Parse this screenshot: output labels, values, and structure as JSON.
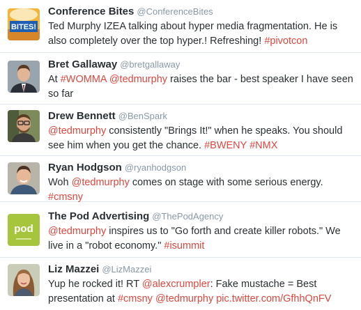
{
  "colors": {
    "link": "#e0463d",
    "name": "#292f33",
    "handle": "#8899a6",
    "divider": "#e1e8ed"
  },
  "tweets": [
    {
      "name": "Conference Bites",
      "handle": "@ConferenceBites",
      "avatar": {
        "icon": "bites-logo",
        "text": "BITES!"
      },
      "segments": [
        {
          "text": "Ted Murphy IZEA talking about hyper media fragmentation. He is also completely over the top hyper.! Refreshing! "
        },
        {
          "text": "#pivotcon"
        }
      ]
    },
    {
      "name": "Bret Gallaway",
      "handle": "@bretgallaway",
      "avatar": {
        "icon": "user-photo"
      },
      "segments": [
        {
          "text": "At "
        },
        {
          "text": "#WOMMA"
        },
        {
          "text": " "
        },
        {
          "text": "@tedmurphy"
        },
        {
          "text": " raises the bar - best speaker I have seen so far"
        }
      ]
    },
    {
      "name": "Drew Bennett",
      "handle": "@BenSpark",
      "avatar": {
        "icon": "user-photo"
      },
      "segments": [
        {
          "text": "@tedmurphy"
        },
        {
          "text": " consistently \"Brings It!\" when he speaks. You should see him when you get the chance. "
        },
        {
          "text": "#BWENY"
        },
        {
          "text": " "
        },
        {
          "text": "#NMX"
        }
      ]
    },
    {
      "name": "Ryan Hodgson",
      "handle": "@ryanhodgson",
      "avatar": {
        "icon": "user-photo"
      },
      "segments": [
        {
          "text": "Woh "
        },
        {
          "text": "@tedmurphy"
        },
        {
          "text": " comes on stage with some serious energy. "
        },
        {
          "text": "#cmsny"
        }
      ]
    },
    {
      "name": "The Pod Advertising",
      "handle": "@ThePodAgency",
      "avatar": {
        "icon": "pod-logo",
        "text": "pod"
      },
      "segments": [
        {
          "text": "@tedmurphy"
        },
        {
          "text": " inspires us to \"Go forth and create killer robots.\" We live in a \"robot economy.\" "
        },
        {
          "text": "#isummit"
        }
      ]
    },
    {
      "name": "Liz Mazzei",
      "handle": "@LizMazzei",
      "avatar": {
        "icon": "user-photo"
      },
      "segments": [
        {
          "text": "Yup he rocked it! RT "
        },
        {
          "text": "@alexcrumpler"
        },
        {
          "text": ": Fake mustache = Best presentation at "
        },
        {
          "text": "#cmsny"
        },
        {
          "text": " "
        },
        {
          "text": "@tedmurphy"
        },
        {
          "text": " "
        },
        {
          "text": "pic.twitter.com/GfhhQnFV"
        }
      ]
    }
  ]
}
